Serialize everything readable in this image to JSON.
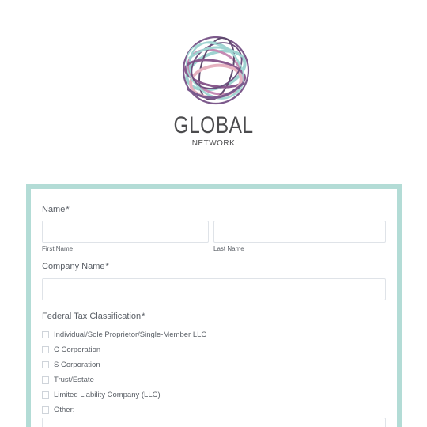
{
  "logo": {
    "title": "GLOBAL",
    "subtitle": "NETWORK",
    "colors": [
      "#8a5a8e",
      "#9fd3d1",
      "#c58ab3",
      "#5f4a6e",
      "#e6b2c0"
    ]
  },
  "form": {
    "border_color": "#b3dcd6",
    "name": {
      "label": "Name",
      "required_mark": "*",
      "first_label": "First Name",
      "last_label": "Last Name",
      "first_value": "",
      "last_value": ""
    },
    "company": {
      "label": "Company Name",
      "required_mark": "*",
      "value": ""
    },
    "tax": {
      "label": "Federal Tax Classification",
      "required_mark": "*",
      "options": [
        "Individual/Sole Proprietor/Single-Member LLC",
        "C Corporation",
        "S Corporation",
        "Trust/Estate",
        "Limited Liability Company (LLC)",
        "Other:"
      ],
      "other_value": ""
    }
  }
}
